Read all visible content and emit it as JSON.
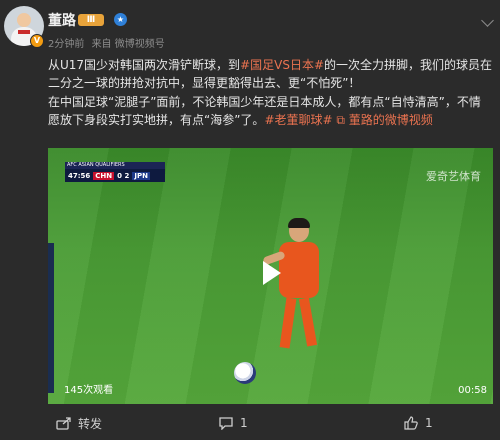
{
  "post": {
    "author": "董路",
    "level_badge": "Ⅲ",
    "time": "2分钟前",
    "source": "来自 微博视频号",
    "text": {
      "l1_before": "从U17国少对韩国两次滑铲断球，到",
      "tag1": "#国足VS日本#",
      "l1_after": "的一次全力拼脚，我们的球员在二分之一球的拼抢对抗中，显得更豁得出去、更“不怕死”！",
      "l2_main": "在中国足球“泥腿子”面前，不论韩国少年还是日本成人，都有点“自恃清高”，不情愿放下身段实打实地拼，有点“海参”了。",
      "tag2": "#老董聊球#",
      "video_link": "董路的微博视频"
    }
  },
  "video": {
    "scoreboard_title": "AFC ASIAN QUALIFIERS",
    "clock": "47:56",
    "home": "CHN",
    "score": "0 2",
    "away": "JPN",
    "brand": "爱奇艺体育",
    "views": "145次观看",
    "duration": "00:58"
  },
  "actions": {
    "share_label": "转发",
    "comment_count": "1",
    "like_count": "1"
  }
}
